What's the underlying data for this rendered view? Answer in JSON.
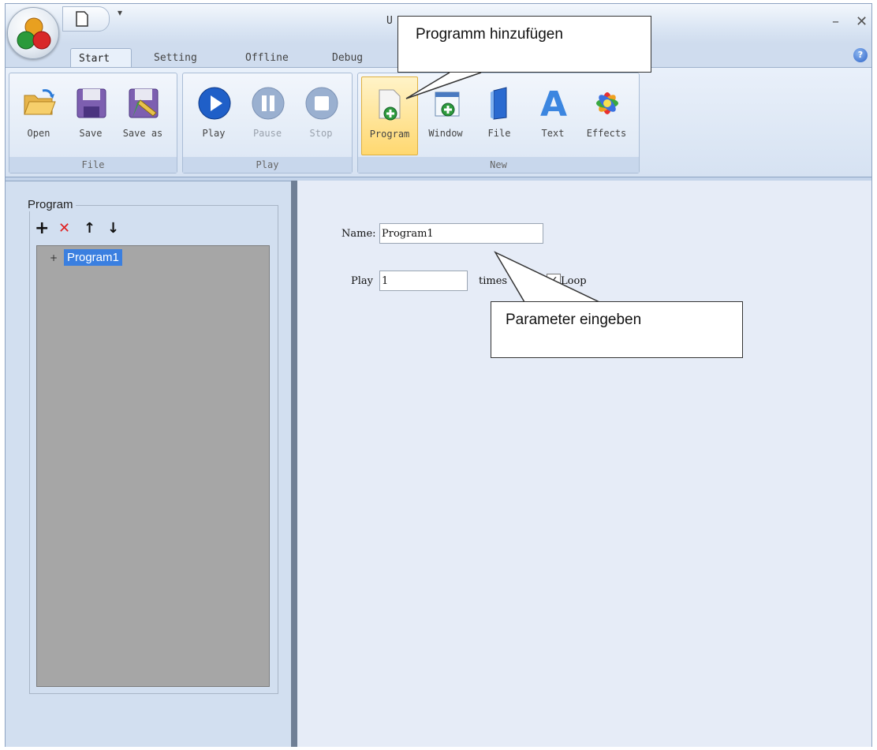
{
  "window": {
    "title": "U"
  },
  "tabs": [
    {
      "label": "Start",
      "active": true
    },
    {
      "label": "Setting",
      "active": false
    },
    {
      "label": "Offline",
      "active": false
    },
    {
      "label": "Debug",
      "active": false
    }
  ],
  "ribbon": {
    "groups": {
      "file": {
        "label": "File",
        "buttons": [
          {
            "label": "Open",
            "icon": "folder-open-icon"
          },
          {
            "label": "Save",
            "icon": "floppy-disk-icon"
          },
          {
            "label": "Save as",
            "icon": "save-as-icon"
          }
        ]
      },
      "play": {
        "label": "Play",
        "buttons": [
          {
            "label": "Play",
            "icon": "play-icon",
            "enabled": true
          },
          {
            "label": "Pause",
            "icon": "pause-icon",
            "enabled": false
          },
          {
            "label": "Stop",
            "icon": "stop-icon",
            "enabled": false
          }
        ]
      },
      "new": {
        "label": "New",
        "buttons": [
          {
            "label": "Program",
            "icon": "add-program-icon",
            "highlighted": true
          },
          {
            "label": "Window",
            "icon": "add-window-icon"
          },
          {
            "label": "File",
            "icon": "file-book-icon"
          },
          {
            "label": "Text",
            "icon": "text-a-icon"
          },
          {
            "label": "Effects",
            "icon": "effects-flower-icon"
          }
        ]
      }
    }
  },
  "program_panel": {
    "title": "Program",
    "toolbar": [
      "add-icon",
      "delete-icon",
      "move-up-icon",
      "move-down-icon"
    ],
    "tree": {
      "expander": "+",
      "items": [
        "Program1"
      ]
    }
  },
  "properties": {
    "name_label": "Name:",
    "name_value": "Program1",
    "play_label": "Play",
    "play_value": "1",
    "times_label": "times",
    "loop_label": "Loop",
    "loop_checked": true
  },
  "callouts": {
    "add_program": "Programm hinzufügen",
    "enter_parameters": "Parameter eingeben"
  },
  "colors": {
    "selection": "#3a7fe0",
    "tree_background": "#a6a6a6",
    "highlight": "#ffd870"
  }
}
